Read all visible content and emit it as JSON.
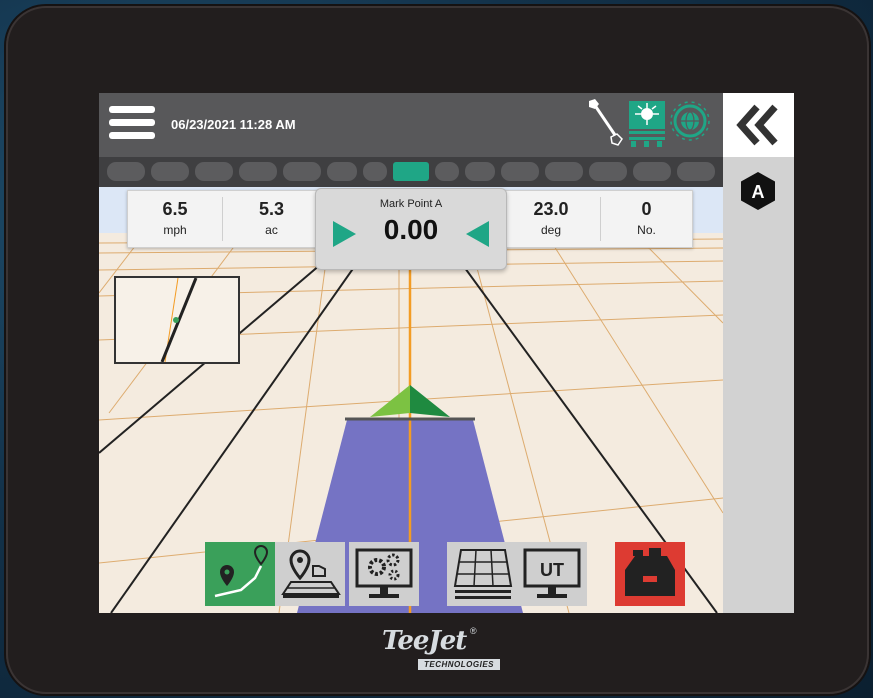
{
  "header": {
    "datetime": "06/23/2021 11:28 AM"
  },
  "guidance": {
    "mode_badge": "A",
    "center": {
      "label": "Mark Point A",
      "value": "0.00"
    },
    "readouts": [
      {
        "value": "6.5",
        "unit": "mph"
      },
      {
        "value": "5.3",
        "unit": "ac"
      },
      {
        "value": "23.0",
        "unit": "deg"
      },
      {
        "value": "0",
        "unit": "No."
      }
    ]
  },
  "sections": {
    "count": 15,
    "active_index": 7
  },
  "bottom_buttons": [
    {
      "id": "guidance",
      "icon": "guidance-ab-icon"
    },
    {
      "id": "marker",
      "icon": "map-marker-point-icon"
    },
    {
      "id": "settings",
      "icon": "settings-gears-monitor-icon"
    },
    {
      "id": "field",
      "icon": "field-grid-icon"
    },
    {
      "id": "ut",
      "label": "UT",
      "icon": "universal-terminal-icon"
    },
    {
      "id": "product",
      "icon": "product-toolbox-icon"
    }
  ],
  "icons": {
    "menu": "hamburger-menu-icon",
    "boom": "boom-line-icon",
    "gnss": "gnss-antenna-icon",
    "globe": "globe-status-icon",
    "collapse": "double-chevron-left-icon"
  },
  "colors": {
    "accent": "#1fa686",
    "guideline": "#f39c24",
    "coverage": "#7573c4",
    "active_button": "#3aa05a",
    "alert_button": "#dd3b32"
  },
  "brand": {
    "logo_text": "TeeJet",
    "logo_subtitle": "TECHNOLOGIES"
  }
}
